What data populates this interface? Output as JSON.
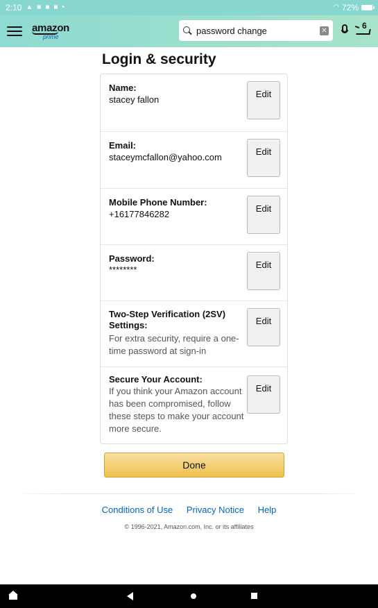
{
  "status_bar": {
    "time": "2:10",
    "notification_icons": [
      "alert-icon",
      "notification-icon",
      "notification-icon",
      "notification-icon",
      "dot-icon"
    ],
    "battery_percent": "72%"
  },
  "header": {
    "logo_text": "amazon",
    "logo_sub": "prime",
    "search_value": "password change",
    "cart_count": "6"
  },
  "page": {
    "title": "Login & security"
  },
  "rows": [
    {
      "label": "Name:",
      "value": "stacey fallon",
      "edit_label": "Edit"
    },
    {
      "label": "Email:",
      "value": "staceymcfallon@yahoo.com",
      "edit_label": "Edit"
    },
    {
      "label": "Mobile Phone Number:",
      "value": "+16177846282",
      "edit_label": "Edit"
    },
    {
      "label": "Password:",
      "value": "********",
      "edit_label": "Edit"
    },
    {
      "label": "Two-Step Verification (2SV) Settings:",
      "value": "For extra security, require a one-time password at sign-in",
      "edit_label": "Edit"
    },
    {
      "label": "Secure Your Account:",
      "value": "If you think your Amazon account has been compromised, follow these steps to make your account more secure.",
      "edit_label": "Edit"
    }
  ],
  "done_label": "Done",
  "footer": {
    "links": [
      "Conditions of Use",
      "Privacy Notice",
      "Help"
    ],
    "copyright": "© 1996-2021, Amazon.com, Inc. or its affiliates"
  },
  "colors": {
    "header": "#8fdad2",
    "button_primary": "#f0c14b",
    "link": "#0066c0"
  }
}
